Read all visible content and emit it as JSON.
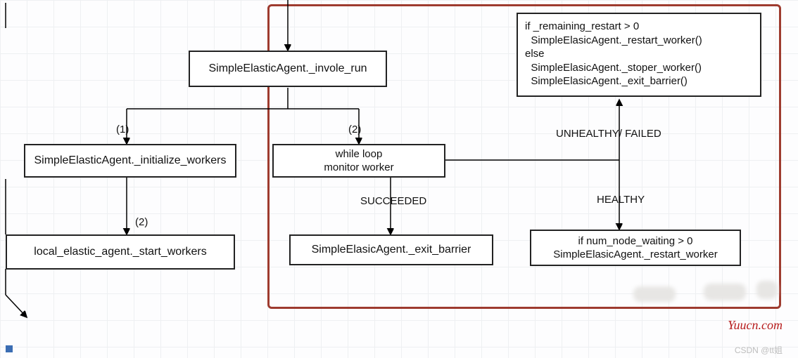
{
  "nodes": {
    "invoke_run": "SimpleElasticAgent._invole_run",
    "init_workers": "SimpleElasticAgent._initialize_workers",
    "start_workers": "local_elastic_agent._start_workers",
    "while_loop": "while loop\nmonitor worker",
    "exit_barrier": "SimpleElasicAgent._exit_barrier",
    "restart_branch": "if _remaining_restart > 0\n  SimpleElasicAgent._restart_worker()\nelse\n  SimpleElasicAgent._stoper_worker()\n  SimpleElasicAgent._exit_barrier()",
    "healthy_branch": "if num_node_waiting > 0\nSimpleElasicAgent._restart_worker"
  },
  "edges": {
    "one_a": "(1)",
    "two_a": "(2)",
    "two_b": "(2)",
    "succeeded": "SUCCEEDED",
    "unhealthy": "UNHEALTHY/ FAILED",
    "healthy": "HEALTHY"
  },
  "credits": {
    "csdn": "CSDN @tt姐",
    "yuucn": "Yuucn.com"
  }
}
